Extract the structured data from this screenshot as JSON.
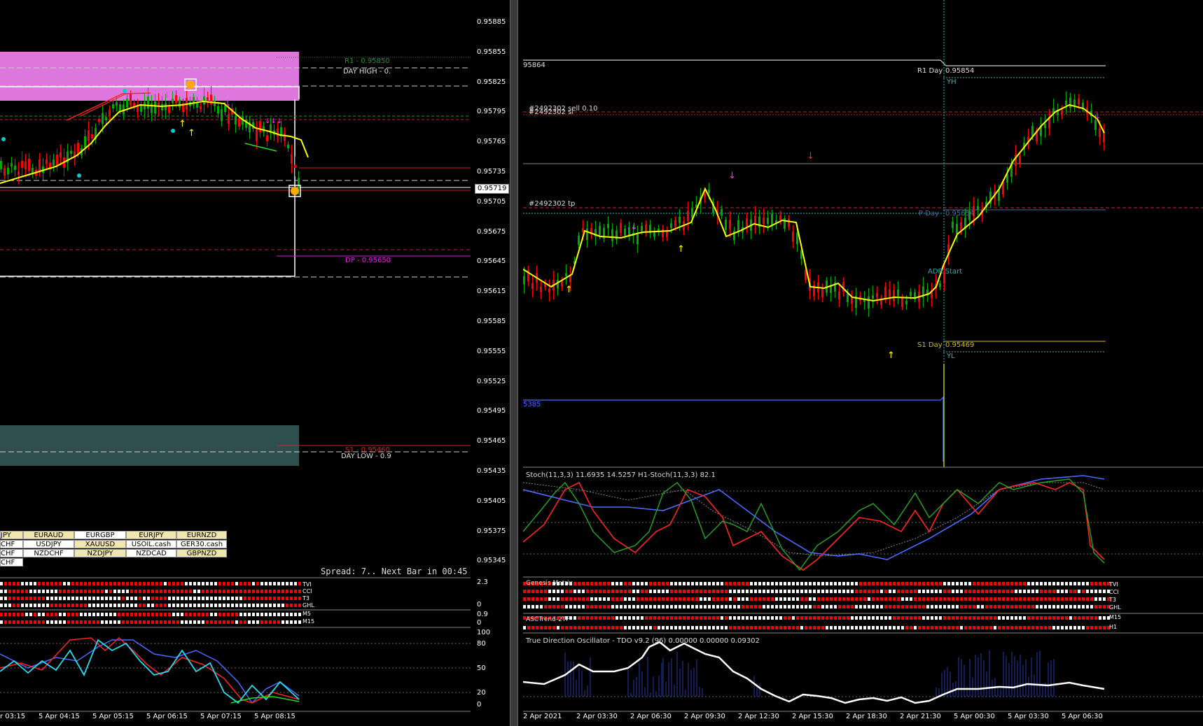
{
  "left_chart": {
    "price_axis": [
      "0.95885",
      "0.95855",
      "0.95825",
      "0.95795",
      "0.95765",
      "0.95735",
      "0.95705",
      "0.95675",
      "0.95645",
      "0.95615",
      "0.95585",
      "0.95555",
      "0.95525",
      "0.95495",
      "0.95465",
      "0.95435",
      "0.95405",
      "0.95375",
      "0.95345"
    ],
    "current_price": "0.95719",
    "r1_label": "R1 - 0.95850",
    "day_high_label": "DAY HIGH - 0.",
    "dp_label": "DP - 0.95650",
    "s1_label": "S1 - 0.95460",
    "day_low_label": "DAY LOW - 0.9",
    "spread_text": "Spread: 7.. Next Bar in 00:45",
    "symbols": [
      [
        "JPY",
        "EURAUD",
        "EURGBP",
        "EURJPY",
        "EURNZD"
      ],
      [
        "CHF",
        "USDJPY",
        "XAUUSD",
        "USOIL.cash",
        "GER30.cash"
      ],
      [
        "CHF",
        "NZDCHF",
        "NZDJPY",
        "NZDCAD",
        "GBPNZD"
      ],
      [
        "CHF"
      ]
    ],
    "panel1_scale": [
      "2.3",
      "0"
    ],
    "panel1_labels": [
      "TVI",
      "CCI",
      "T3",
      "GHL"
    ],
    "panel2_scale": [
      "0.9",
      "0"
    ],
    "panel2_labels": [
      "M5",
      "M15"
    ],
    "stoch_scale": [
      "100",
      "80",
      "50",
      "20",
      "0"
    ],
    "time_axis": [
      "r 03:15",
      "5 Apr 04:15",
      "5 Apr 05:15",
      "5 Apr 06:15",
      "5 Apr 07:15",
      "5 Apr 08:15"
    ]
  },
  "right_chart": {
    "level_95864": "95864",
    "r1_day": "R1 Day",
    "r1_value": "0.95854",
    "yh": "YH",
    "order_sell": "#2492302 sell 0.10",
    "order_sl": "#2492302 sl",
    "order_tp": "#2492302 tp",
    "p_day": "P Day",
    "p_value": "0.95654",
    "adr_start": "ADR Start",
    "s1_day": "S1 Day",
    "s1_value": "0.95469",
    "yl": "YL",
    "level_5385": "5385",
    "stoch_title": "Stoch(11,3,3) 11.6935 14.5257  H1-Stoch(11,3,3)  82.1",
    "genesis_title": "Genesis Matrix",
    "genesis_labels": [
      "TVI",
      "CCI",
      "T3",
      "GHL"
    ],
    "asctrend_title": "ASCTrend-2TF",
    "asctrend_labels": [
      "M15",
      "H1"
    ],
    "tdo_title": "True Direction Oscillator - TDO v9.2 (96) 0.00000 0.00000 0.09302",
    "time_axis": [
      "2 Apr 2021",
      "2 Apr 03:30",
      "2 Apr 06:30",
      "2 Apr 09:30",
      "2 Apr 12:30",
      "2 Apr 15:30",
      "2 Apr 18:30",
      "2 Apr 21:30",
      "5 Apr 00:30",
      "5 Apr 03:30",
      "5 Apr 06:30"
    ]
  },
  "colors": {
    "bull": "#00aa00",
    "bear": "#ff0000",
    "ma": "#ffff00",
    "resistance_zone": "#dd77dd",
    "support_zone": "#2f4f4f",
    "symbol_yellow": "#f0e6b0",
    "symbol_white": "#ffffff"
  }
}
